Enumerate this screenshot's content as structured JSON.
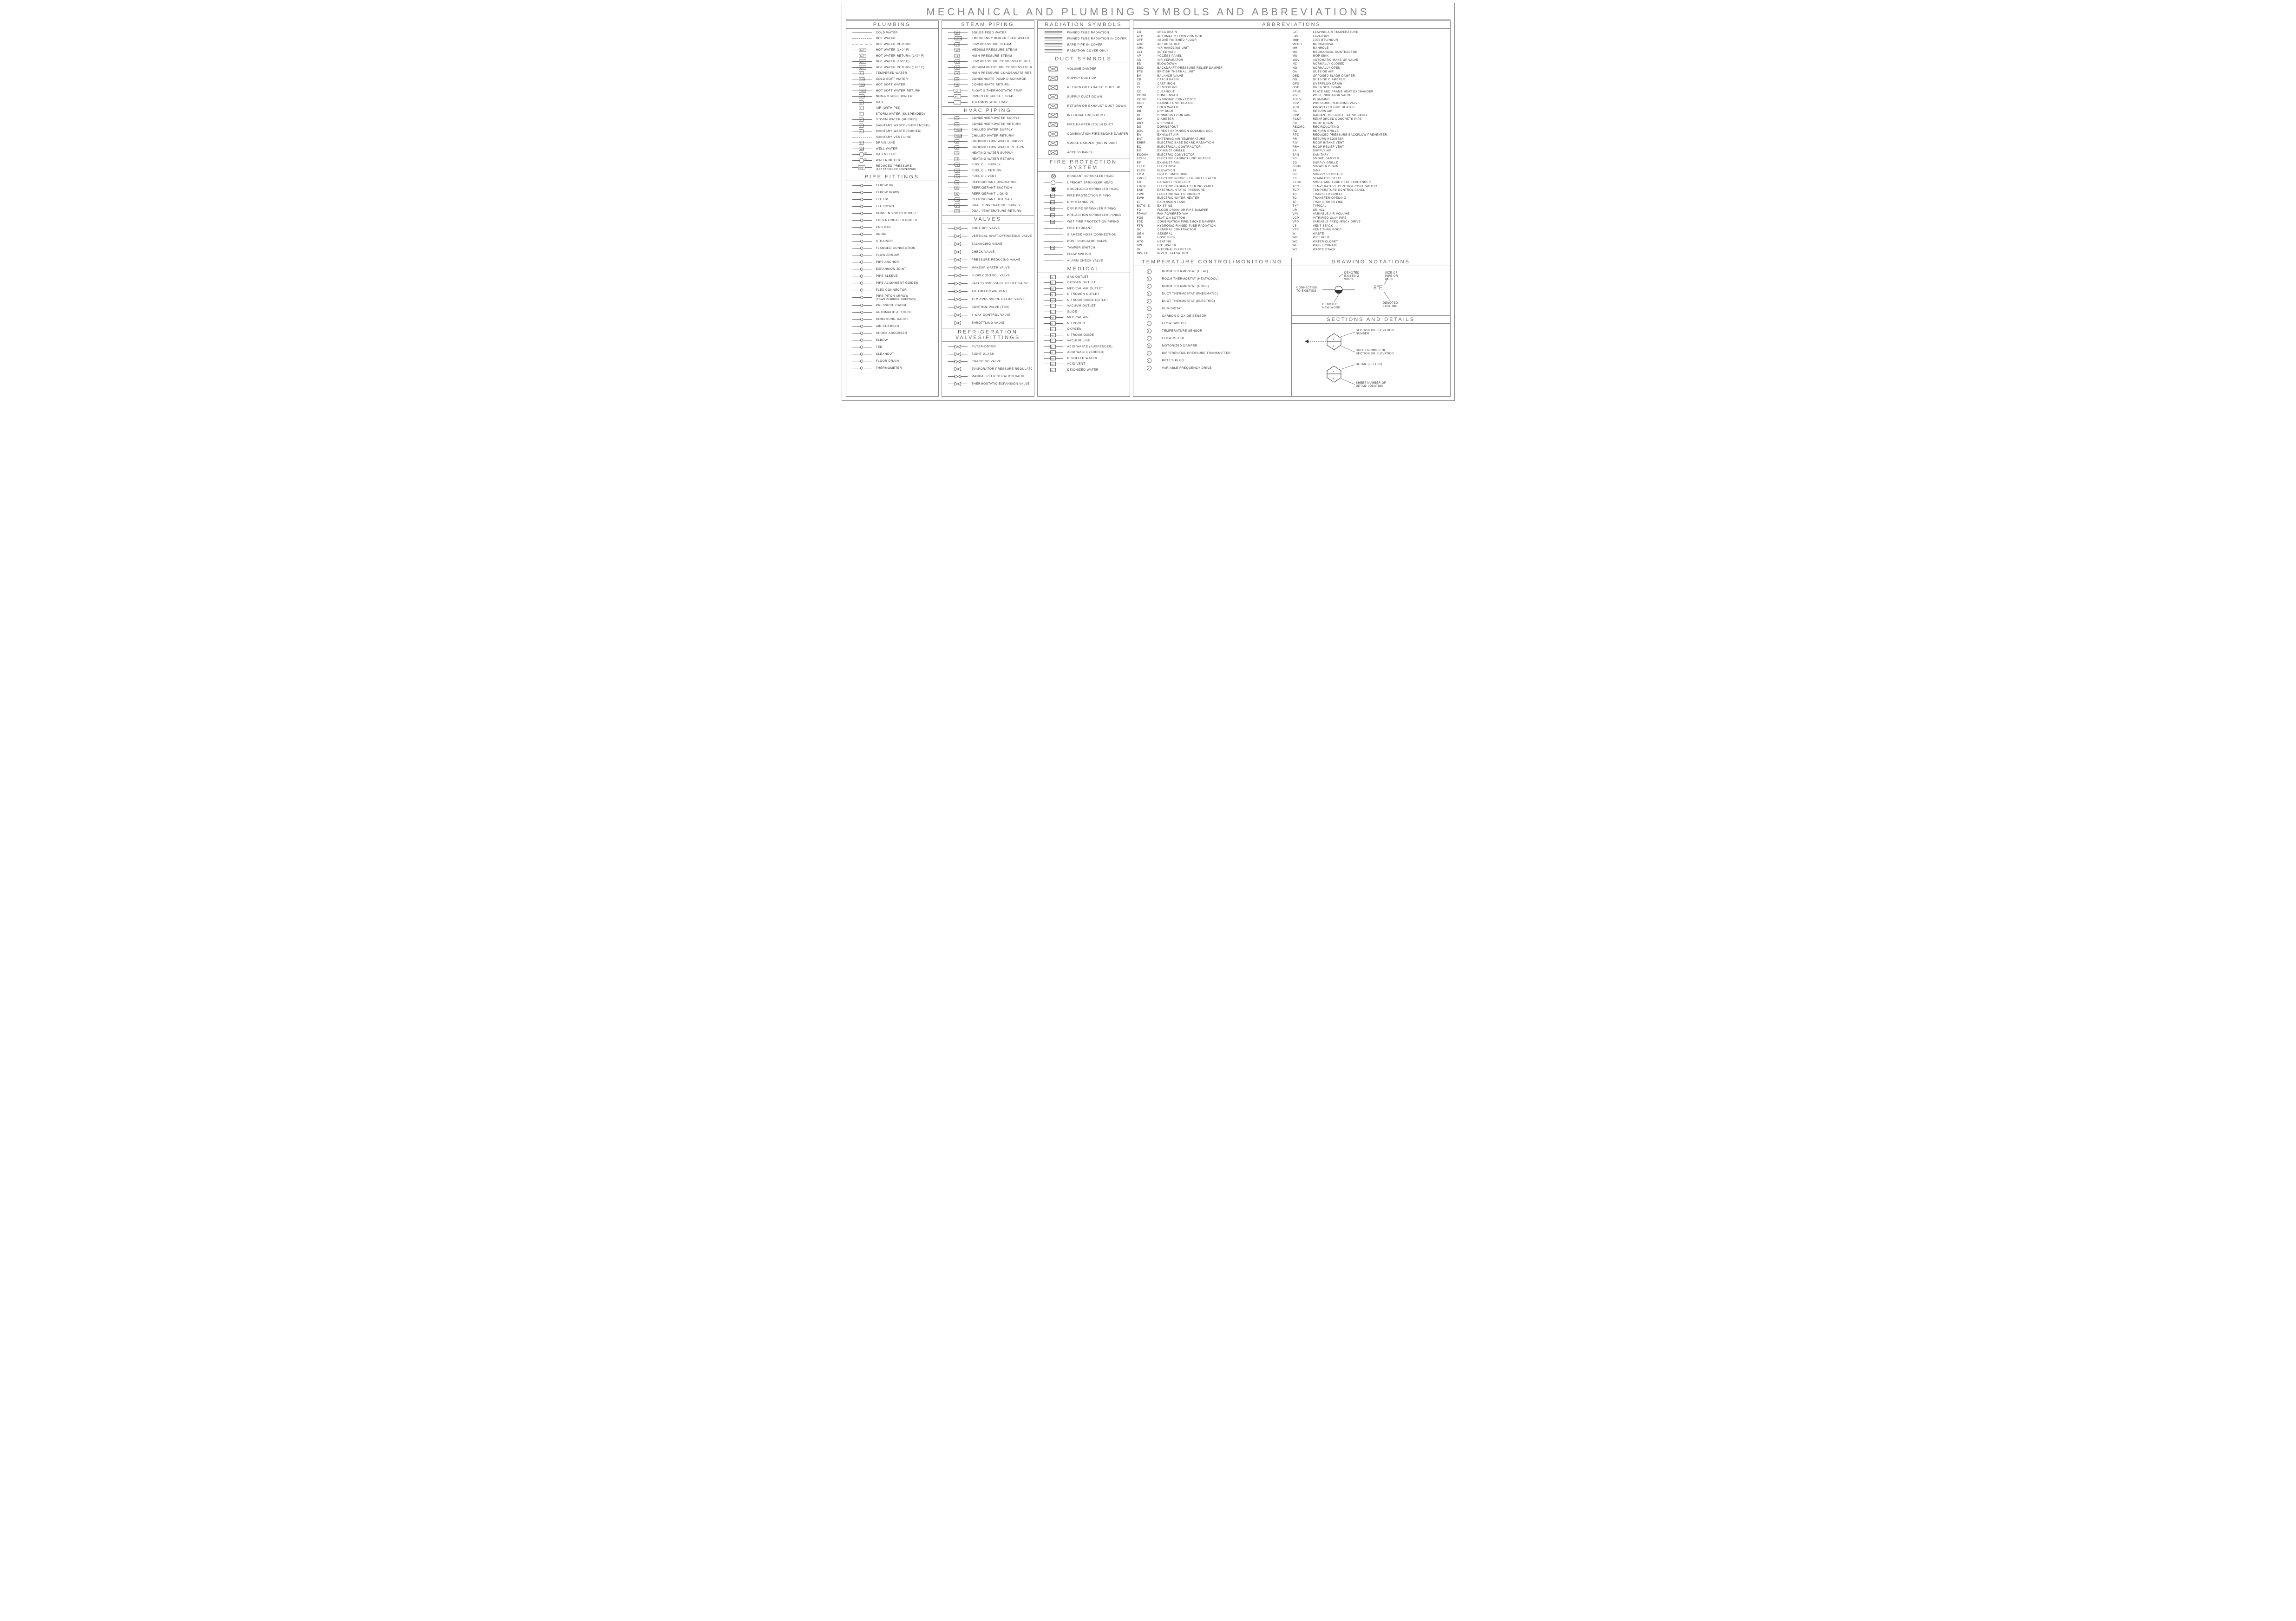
{
  "title": "MECHANICAL AND PLUMBING SYMBOLS AND ABBREVIATIONS",
  "sections": {
    "plumbing": {
      "title": "PLUMBING",
      "items": [
        {
          "tag": "",
          "label": "COLD WATER"
        },
        {
          "tag": "",
          "label": "HOT WATER",
          "style": "dash"
        },
        {
          "tag": "",
          "label": "HOT WATER RETURN",
          "style": "dot"
        },
        {
          "tag": "140°",
          "label": "HOT WATER (140° F)"
        },
        {
          "tag": "140°",
          "label": "HOT WATER RETURN (140° F)"
        },
        {
          "tag": "180°",
          "label": "HOT WATER (180° F)"
        },
        {
          "tag": "180°",
          "label": "HOT WATER RETURN (180° F)"
        },
        {
          "tag": "T",
          "label": "TEMPERED WATER"
        },
        {
          "tag": "CSW",
          "label": "COLD SOFT WATER"
        },
        {
          "tag": "HSW",
          "label": "HOT SOFT WATER"
        },
        {
          "tag": "HSWR",
          "label": "HOT SOFT WATER RETURN"
        },
        {
          "tag": "NPW",
          "label": "NON-POTABLE WATER"
        },
        {
          "tag": "G",
          "label": "GAS"
        },
        {
          "tag": "A",
          "label": "AIR (WITH PSI)"
        },
        {
          "tag": "/",
          "label": "STORM WATER (SUSPENDED)"
        },
        {
          "tag": "//",
          "label": "STORM WATER (BURIED)"
        },
        {
          "tag": "||",
          "label": "SANITARY WASTE (SUSPENDED)"
        },
        {
          "tag": "//",
          "label": "SANITARY WASTE (BURIED)"
        },
        {
          "tag": "",
          "label": "SANITARY VENT LINE",
          "style": "dash"
        },
        {
          "tag": "D",
          "label": "DRAIN LINE"
        },
        {
          "tag": "WW",
          "label": "WELL WATER"
        },
        {
          "tag": "GM",
          "label": "GAS METER",
          "icon": "circ"
        },
        {
          "tag": "WM",
          "label": "WATER METER",
          "icon": "circ"
        },
        {
          "tag": "RPBP",
          "label": "REDUCED PRESSURE",
          "extra": "(RPZ   BACKFLOW PREVENTER)",
          "icon": "box"
        }
      ]
    },
    "pipe_fittings": {
      "title": "PIPE FITTINGS",
      "items": [
        {
          "label": "ELBOW UP"
        },
        {
          "label": "ELBOW DOWN"
        },
        {
          "label": "TEE UP"
        },
        {
          "label": "TEE DOWN"
        },
        {
          "label": "CONCENTRIC REDUCER"
        },
        {
          "label": "ECCENTRICAL REDUCER"
        },
        {
          "label": "END CAP"
        },
        {
          "label": "UNION"
        },
        {
          "label": "STRAINER"
        },
        {
          "label": "FLANGED CONNECTION"
        },
        {
          "label": "FLOW ARROW"
        },
        {
          "label": "PIPE ANCHOR"
        },
        {
          "label": "EXPANSION JOINT"
        },
        {
          "label": "PIPE SLEEVE"
        },
        {
          "label": "PIPE ALIGNMENT GUIDES"
        },
        {
          "label": "FLEX CONNECTOR"
        },
        {
          "label": "PIPE PITCH ARROW",
          "extra": "(DOWN IN ARROW DIRECTION)"
        },
        {
          "label": "PRESSURE GAUGE"
        },
        {
          "label": "AUTOMATIC AIR VENT"
        },
        {
          "label": "COMPOUND GAUGE"
        },
        {
          "label": "AIR CHAMBER"
        },
        {
          "label": "SHOCK ABSORBER"
        },
        {
          "label": "ELBOW"
        },
        {
          "label": "TEE"
        },
        {
          "label": "CLEANOUT",
          "tag": "CO"
        },
        {
          "label": "FLOOR DRAIN",
          "tag": "FD"
        },
        {
          "label": "THERMOMETER"
        }
      ]
    },
    "steam": {
      "title": "STEAM PIPING",
      "items": [
        {
          "tag": "BFW",
          "label": "BOILER FEED WATER"
        },
        {
          "tag": "EBFW",
          "label": "EMERGENCY BOILER FEED WATER"
        },
        {
          "tag": "LPS",
          "label": "LOW PRESSURE STEAM"
        },
        {
          "tag": "MPS",
          "label": "MEDIUM PRESSURE STEAM"
        },
        {
          "tag": "HPS",
          "label": "HIGH PRESSURE STEAM"
        },
        {
          "tag": "LPR",
          "label": "LOW PRESSURE CONDENSATE RETURN"
        },
        {
          "tag": "MPR",
          "label": "MEDIUM PRESSURE CONDENSATE RETURN"
        },
        {
          "tag": "HPR",
          "label": "HIGH PRESSURE CONDENSATE RETURN"
        },
        {
          "tag": "PD",
          "label": "CONDENSATE PUMP DISCHARGE"
        },
        {
          "tag": "CR",
          "label": "CONDENSATE RETURN"
        },
        {
          "tag": "F&T",
          "label": "FLOAT & THERMOSTATIC TRAP",
          "icon": "box"
        },
        {
          "tag": "IBT",
          "label": "INVERTED BUCKET TRAP",
          "icon": "box"
        },
        {
          "tag": "",
          "label": "THERMOSTATIC TRAP",
          "icon": "box"
        }
      ]
    },
    "hvac": {
      "title": "HVAC PIPING",
      "items": [
        {
          "tag": "CS",
          "label": "CONDENSER WATER SUPPLY"
        },
        {
          "tag": "CR",
          "label": "CONDENSER WATER RETURN"
        },
        {
          "tag": "CHWS",
          "label": "CHILLED WATER SUPPLY"
        },
        {
          "tag": "CHWR",
          "label": "CHILLED WATER RETURN"
        },
        {
          "tag": "GS",
          "label": "GROUND LOOP WATER SUPPLY"
        },
        {
          "tag": "GR",
          "label": "GROUND LOOP WATER RETURN"
        },
        {
          "tag": "HS",
          "label": "HEATING WATER SUPPLY"
        },
        {
          "tag": "HR",
          "label": "HEATING WATER RETURN"
        },
        {
          "tag": "FOS",
          "label": "FUEL OIL SUPPLY"
        },
        {
          "tag": "FOR",
          "label": "FUEL OIL RETURN"
        },
        {
          "tag": "FOV",
          "label": "FUEL OIL VENT"
        },
        {
          "tag": "RD",
          "label": "REFRIGERANT DISCHARGE"
        },
        {
          "tag": "RS",
          "label": "REFRIGERANT SUCTION"
        },
        {
          "tag": "RL",
          "label": "REFRIGERANT LIQUID"
        },
        {
          "tag": "RHG",
          "label": "REFRIGERANT HOT GAS"
        },
        {
          "tag": "DTS",
          "label": "DUAL TEMPERATURE SUPPLY"
        },
        {
          "tag": "DTR",
          "label": "DUAL TEMPERATURE RETURN"
        }
      ]
    },
    "valves": {
      "title": "VALVES",
      "items": [
        {
          "label": "SHUT-OFF VALVE"
        },
        {
          "label": "VERTICAL SHUT-OFF/NEEDLE VALVE"
        },
        {
          "label": "BALANCING VALVE"
        },
        {
          "label": "CHECK VALVE"
        },
        {
          "label": "PRESSURE REDUCING VALVE"
        },
        {
          "label": "MAKEUP WATER VALVE"
        },
        {
          "label": "FLOW CONTROL VALVE"
        },
        {
          "label": "SAFETY/PRESSURE RELIEF VALVE"
        },
        {
          "label": "AUTOMATIC AIR VENT"
        },
        {
          "label": "TEMP/PRESSURE RELIEF VALVE"
        },
        {
          "label": "CONTROL VALVE (TCV)"
        },
        {
          "label": "3-WAY CONTROL VALVE"
        },
        {
          "label": "THROTTLING VALVE"
        }
      ]
    },
    "refrig": {
      "title": "REFRIGERATION VALVES/FITTINGS",
      "items": [
        {
          "label": "FILTER-DRYER"
        },
        {
          "label": "SIGHT GLASS"
        },
        {
          "label": "CHARGING VALVE"
        },
        {
          "label": "EVAPORATOR PRESSURE REGULATOR"
        },
        {
          "label": "MANUAL REFRIGERATION VALVE"
        },
        {
          "label": "THERMOSTATIC EXPANSION VALVE"
        }
      ]
    },
    "radiation": {
      "title": "RADIATION SYMBOLS",
      "items": [
        {
          "label": "FINNED TUBE RADIATION"
        },
        {
          "label": "FINNED TUBE RADIATION IN COVER"
        },
        {
          "label": "BARE PIPE IN COVER"
        },
        {
          "label": "RADIATION COVER ONLY"
        }
      ]
    },
    "duct": {
      "title": "DUCT SYMBOLS",
      "items": [
        {
          "label": "VOLUME DAMPER"
        },
        {
          "label": "SUPPLY DUCT UP"
        },
        {
          "label": "RETURN OR EXHAUST DUCT UP"
        },
        {
          "label": "SUPPLY DUCT DOWN"
        },
        {
          "label": "RETURN OR EXHAUST DUCT DOWN"
        },
        {
          "label": "INTERNAL LINED DUCT"
        },
        {
          "label": "FIRE DAMPER (FD) IN DUCT",
          "tag": "FD"
        },
        {
          "label": "COMBINATION FIRE/SMOKE DAMPER (FSD) IN DUCT",
          "tag": "FSD"
        },
        {
          "label": "SMOKE DAMPER (SD) IN DUCT"
        },
        {
          "label": "ACCESS PANEL",
          "tag": "AP"
        }
      ]
    },
    "fire": {
      "title": "FIRE PROTECTION SYSTEM",
      "items": [
        {
          "label": "PENDANT SPRINKLER HEAD",
          "icon": "circx"
        },
        {
          "label": "UPRIGHT  SPRINKLER HEAD",
          "icon": "circ"
        },
        {
          "label": "CONCEALED SPRINKLER HEAD",
          "icon": "circfill"
        },
        {
          "tag": "F",
          "label": "FIRE PROTECTION PIPING"
        },
        {
          "tag": "DS",
          "label": "DRY STANDPIPE"
        },
        {
          "tag": "DP",
          "label": "DRY PIPE SPRINKLER PIPING"
        },
        {
          "tag": "PA",
          "label": "PRE-ACTION SPRINKLER PIPING"
        },
        {
          "tag": "WF",
          "label": "WET FIRE PROTECTION PIPING"
        },
        {
          "label": "FIRE HYDRANT"
        },
        {
          "label": "SIAMESE HOSE CONNECTION"
        },
        {
          "label": "POST INDICATOR VALVE"
        },
        {
          "label": "TAMPER SWITCH",
          "tag": "TS"
        },
        {
          "label": "FLOW SWITCH"
        },
        {
          "label": "ALARM CHECK VALVE"
        }
      ]
    },
    "medical": {
      "title": "MEDICAL",
      "items": [
        {
          "tag": "G",
          "label": "GAS OUTLET"
        },
        {
          "tag": "O",
          "label": "OXYGEN OUTLET"
        },
        {
          "tag": "MA",
          "label": "MEDICAL AIR OUTLET"
        },
        {
          "tag": "N",
          "label": "NITROGEN OUTLET"
        },
        {
          "tag": "NOM",
          "label": "NITROUS OXIDE OUTLET"
        },
        {
          "tag": "V",
          "label": "VACUUM OUTLET"
        },
        {
          "tag": "S",
          "label": "SLIDE"
        },
        {
          "tag": "MA",
          "label": "MEDICAL AIR"
        },
        {
          "tag": "N",
          "label": "NITROGEN"
        },
        {
          "tag": "O",
          "label": "OXYGEN"
        },
        {
          "tag": "NO",
          "label": "NITROUS OXIDE"
        },
        {
          "tag": "V",
          "label": "VACUUM LINE"
        },
        {
          "tag": "||",
          "label": "ACID WASTE (SUSPENDED)"
        },
        {
          "tag": "///",
          "label": "ACID WASTE (BURIED)"
        },
        {
          "tag": "DW",
          "label": "DISTILLED WATER"
        },
        {
          "tag": "AV",
          "label": "ACID VENT"
        },
        {
          "tag": "DI",
          "label": "DEIONIZED WATER"
        }
      ]
    },
    "temp": {
      "title": "TEMPERATURE  CONTROL/MONITORING",
      "items": [
        {
          "tag": "T",
          "label": "ROOM THERMOSTAT (HEAT)"
        },
        {
          "tag": "T H/C",
          "label": "ROOM THERMOSTAT (HEAT/COOL)"
        },
        {
          "tag": "T",
          "label": "ROOM THERMOSTAT (COOL)"
        },
        {
          "tag": "T",
          "label": "DUCT THERMOSTAT (PNEUMATIC)"
        },
        {
          "tag": "T",
          "label": "DUCT THERMOSTAT (ELECTRIC)"
        },
        {
          "tag": "H",
          "label": "HUMIDISTAT"
        },
        {
          "tag": "CO₂",
          "label": "CARBON DIOXIDE SENSOR"
        },
        {
          "tag": "FS",
          "label": "FLOW SWITCH"
        },
        {
          "tag": "",
          "label": "TEMPERATURE SENSOR"
        },
        {
          "tag": "FM",
          "label": "FLOW METER"
        },
        {
          "tag": "M",
          "label": "MOTORIZED DAMPER"
        },
        {
          "tag": "DP",
          "label": "DIFFERENTIAL PRESSURE TRANSMITTER"
        },
        {
          "tag": "",
          "label": "PETE'S PLUG"
        },
        {
          "tag": "VFD",
          "label": "VARIABLE FREQUENCY DRIVE"
        }
      ]
    },
    "notations": {
      "title": "DRAWING NOTATIONS",
      "labels": {
        "existing_work": "DENOTED EXISTING WORK",
        "new_work": "DENOTED NEW WORK",
        "conn_existing": "CONNECTION TO EXISTING",
        "size_pipe": "SIZE OF PIPE OR DUCT",
        "example_size": "8\"E.",
        "denoted_existing": "DENOTED EXISTING"
      }
    },
    "sections_details": {
      "title": "SECTIONS AND DETAILS",
      "labels": {
        "section_num": "SECTION OR ELEVATION NUMBER",
        "sheet_num1": "SHEET NUMBER OF SECTION OR ELEVATION",
        "detail": "DETAIL (LETTER)",
        "sheet_num2": "SHEET NUMBER OF DETAIL LOCATION"
      }
    }
  },
  "abbreviations": [
    [
      "AD",
      "AREA DRAIN"
    ],
    [
      "AFC",
      "AUTOMATIC FLOW CONTROL"
    ],
    [
      "AFF",
      "ABOVE FINISHED FLOOR"
    ],
    [
      "AHR",
      "AIR HOSE REEL"
    ],
    [
      "AHU",
      "AIR HANDLING UNIT"
    ],
    [
      "ALT",
      "ALTERNATE"
    ],
    [
      "AP",
      "ACCESS PANEL"
    ],
    [
      "AS",
      "AIR SEPARATOR"
    ],
    [
      "BD",
      "BLOWDOWN"
    ],
    [
      "BDD",
      "BACKDRAFT/PRESSURE RELIEF DAMPER"
    ],
    [
      "BTU",
      "BRITISH THERMAL UNIT"
    ],
    [
      "BV",
      "BALANCE VALVE"
    ],
    [
      "CB",
      "CATCH BASIN"
    ],
    [
      "CI",
      "CAST IRON"
    ],
    [
      "CL",
      "CENTERLINE"
    ],
    [
      "CO",
      "CLEANOUT"
    ],
    [
      "COND",
      "CONDENSATE"
    ],
    [
      "CONV",
      "HYDRONIC CONVECTOR"
    ],
    [
      "CUH",
      "CABINET UNIT HEATER"
    ],
    [
      "CW",
      "COLD WATER"
    ],
    [
      "DB",
      "DRY BULB"
    ],
    [
      "DF",
      "DRINKING FOUNTAIN"
    ],
    [
      "DIA",
      "DIAMETER"
    ],
    [
      "DIFF",
      "DIFFUSER"
    ],
    [
      "DS",
      "DOWNSPOUT"
    ],
    [
      "DXC",
      "DIRECT EXPANSION COOLING COIL"
    ],
    [
      "EA",
      "EXHAUST AIR"
    ],
    [
      "EAT",
      "ENTERING AIR TEMPERATURE"
    ],
    [
      "EBBR",
      "ELECTRIC BASE BOARD RADIATION"
    ],
    [
      "EC",
      "ELECTRICAL CONTRACTOR"
    ],
    [
      "EG",
      "EXHAUST GRILLE"
    ],
    [
      "ECONV",
      "ELECTRIC CONVECTOR"
    ],
    [
      "ECUH",
      "ELECTRIC CABINET UNIT HEATER"
    ],
    [
      "EF",
      "EXHAUST FAN"
    ],
    [
      "ELEC",
      "ELECTRICAL"
    ],
    [
      "ELEV",
      "ELEVATION"
    ],
    [
      "EOM",
      "END OF MAIN DRIP"
    ],
    [
      "EPUH",
      "ELECTRIC PROPELLER UNIT HEATER"
    ],
    [
      "ER",
      "EXHAUST REGISTER"
    ],
    [
      "ERCP",
      "ELECTRIC RADIANT CEILING PANEL"
    ],
    [
      "ESP",
      "EXTERNAL STATIC PRESSURE"
    ],
    [
      "EWC",
      "ELECTRIC WATER COOLER"
    ],
    [
      "EWH",
      "ELECTRIC WATER HEATER"
    ],
    [
      "ET",
      "EXPANSION TANK"
    ],
    [
      "EXTG, E.",
      "EXISTING"
    ],
    [
      "FD",
      "FLOOR DRAIN OR FIRE DAMPER"
    ],
    [
      "FPVAV",
      "FAN POWERED VAV"
    ],
    [
      "FOB",
      "FLAT ON BOTTOM"
    ],
    [
      "FSD",
      "COMBINATION FIRE/SMOKE DAMPER"
    ],
    [
      "FTR",
      "HYDRONIC FINNED TUBE RADIATION"
    ],
    [
      "GC",
      "GENERAL CONTRACTOR"
    ],
    [
      "GEN",
      "GENERAL"
    ],
    [
      "HB",
      "HOSE BIBB"
    ],
    [
      "HTG",
      "HEATING"
    ],
    [
      "HW",
      "HOT WATER"
    ],
    [
      "ID",
      "INTERNAL DIAMETER"
    ],
    [
      "INV. EL.",
      "INVERT ELEVATION"
    ],
    [
      "LAT",
      "LEAVING AIR TEMPERATURE"
    ],
    [
      "LAV",
      "LAVATORY"
    ],
    [
      "MBH",
      "1000 BTU/HOUR"
    ],
    [
      "MECH",
      "MECHANICAL"
    ],
    [
      "MH",
      "MANHOLE"
    ],
    [
      "MC",
      "MECHANICAL CONTRACTOR"
    ],
    [
      "MS",
      "MOP SINK"
    ],
    [
      "MUV",
      "AUTOMATIC MAKE-UP VALVE"
    ],
    [
      "NC",
      "NORMALLY CLOSED"
    ],
    [
      "NO",
      "NORMALLY OPEN"
    ],
    [
      "OA",
      "OUTSIDE AIR"
    ],
    [
      "OBD",
      "OPPOSED BLADE DAMPER"
    ],
    [
      "OD",
      "OUTSIDE DIAMETER"
    ],
    [
      "OFD",
      "OVERFLOW DRAIN"
    ],
    [
      "OSD",
      "OPEN SITE DRAIN"
    ],
    [
      "PFHX",
      "PLATE AND FRAME HEAT EXCHANGER"
    ],
    [
      "PIV",
      "POST INDICATOR VALVE"
    ],
    [
      "PLBG",
      "PLUMBING"
    ],
    [
      "PRV",
      "PRESSURE REDUCING VALVE"
    ],
    [
      "PUH",
      "PROPELLER UNIT HEATER"
    ],
    [
      "RA",
      "RETURN AIR"
    ],
    [
      "RCP",
      "RADIANT CEILING HEATING PANEL"
    ],
    [
      "RCNP",
      "REINFORCED CONCRETE PIPE"
    ],
    [
      "RD",
      "ROOF DRAIN"
    ],
    [
      "RECIRC",
      "RECIRCULATING"
    ],
    [
      "RG",
      "RETURN GRILLE"
    ],
    [
      "RPZ",
      "REDUCED PRESSURE BACKFLOW PREVENTER"
    ],
    [
      "RR",
      "RETURN REGISTER"
    ],
    [
      "RIV",
      "ROOF INTAKE VENT"
    ],
    [
      "RRV",
      "ROOF RELIEF VENT"
    ],
    [
      "SA",
      "SUPPLY AIR"
    ],
    [
      "SAN",
      "SANITARY"
    ],
    [
      "SD",
      "SMOKE DAMPER"
    ],
    [
      "SG",
      "SUPPLY GRILLE"
    ],
    [
      "SHDR",
      "SHOWER DRAIN"
    ],
    [
      "SK",
      "SINK"
    ],
    [
      "SR",
      "SUPPLY REGISTER"
    ],
    [
      "SS",
      "STAINLESS STEEL"
    ],
    [
      "STHX",
      "SHELL AND TUBE HEAT EXCHANGER"
    ],
    [
      "TCC",
      "TEMPERATURE CONTROL CONTRACTOR"
    ],
    [
      "TCP",
      "TEMPERATURE CONTROL PANEL"
    ],
    [
      "TG",
      "TRANSFER GRILLE"
    ],
    [
      "TO",
      "TRANSFER OPENING"
    ],
    [
      "TP",
      "TRAP PRIMER LINE"
    ],
    [
      "TYP",
      "TYPICAL"
    ],
    [
      "UR",
      "URINAL"
    ],
    [
      "VAV",
      "VARIABLE AIR VOLUME"
    ],
    [
      "VCP",
      "VITRIFIED CLAY PIPE"
    ],
    [
      "VFD",
      "VARIABLE FREQUENCY DRIVE"
    ],
    [
      "VS",
      "VENT STACK"
    ],
    [
      "VTR",
      "VENT THRU ROOF"
    ],
    [
      "W",
      "WASTE"
    ],
    [
      "WB",
      "WET BULB"
    ],
    [
      "WC",
      "WATER CLOSET"
    ],
    [
      "WH",
      "WALL HYDRANT"
    ],
    [
      "WS",
      "WASTE STACK"
    ]
  ],
  "abbrev_title": "ABBREVIATIONS"
}
